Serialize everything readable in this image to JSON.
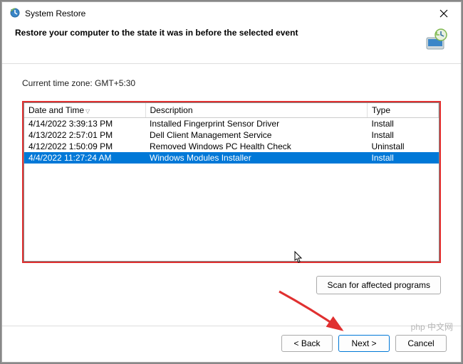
{
  "window": {
    "title": "System Restore"
  },
  "header": {
    "text": "Restore your computer to the state it was in before the selected event"
  },
  "timezone_label": "Current time zone: GMT+5:30",
  "table": {
    "columns": {
      "datetime": "Date and Time",
      "description": "Description",
      "type": "Type"
    },
    "rows": [
      {
        "datetime": "4/14/2022 3:39:13 PM",
        "description": "Installed Fingerprint Sensor Driver",
        "type": "Install",
        "selected": false
      },
      {
        "datetime": "4/13/2022 2:57:01 PM",
        "description": "Dell Client Management Service",
        "type": "Install",
        "selected": false
      },
      {
        "datetime": "4/12/2022 1:50:09 PM",
        "description": "Removed Windows PC Health Check",
        "type": "Uninstall",
        "selected": false
      },
      {
        "datetime": "4/4/2022 11:27:24 AM",
        "description": "Windows Modules Installer",
        "type": "Install",
        "selected": true
      }
    ]
  },
  "buttons": {
    "scan": "Scan for affected programs",
    "back": "< Back",
    "next": "Next >",
    "cancel": "Cancel"
  },
  "watermark": "php 中文网"
}
